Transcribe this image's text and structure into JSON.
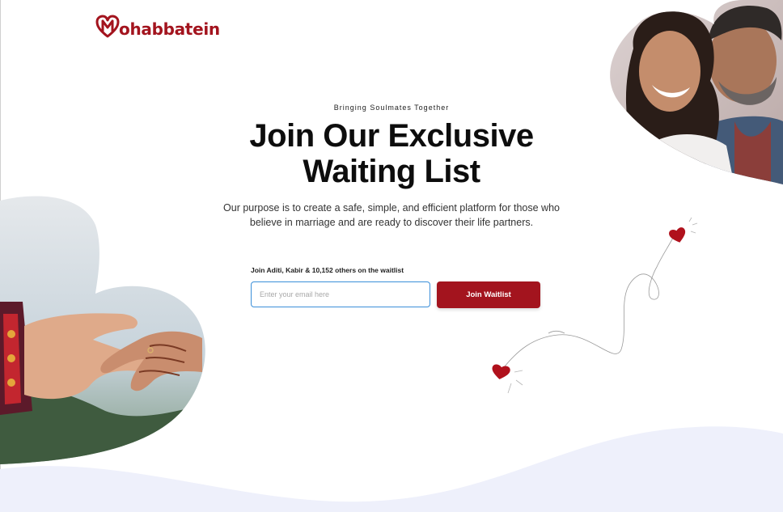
{
  "brand": {
    "name": "ohabbatein",
    "accent": "#a3141e"
  },
  "hero": {
    "tagline": "Bringing Soulmates Together",
    "title_line1": "Join Our Exclusive",
    "title_line2": "Waiting List",
    "description": "Our purpose is to create a safe, simple, and efficient platform for those who believe in marriage and are ready to discover their life partners."
  },
  "waitlist": {
    "label": "Join Aditi, Kabir & 10,152 others on the waitlist",
    "email_placeholder": "Enter your email here",
    "email_value": "",
    "button_label": "Join Waitlist",
    "input_border_color": "#3b8fd9"
  },
  "decor": {
    "heart_icon": "heart-icon",
    "background_wave_color": "#eef0fb"
  }
}
